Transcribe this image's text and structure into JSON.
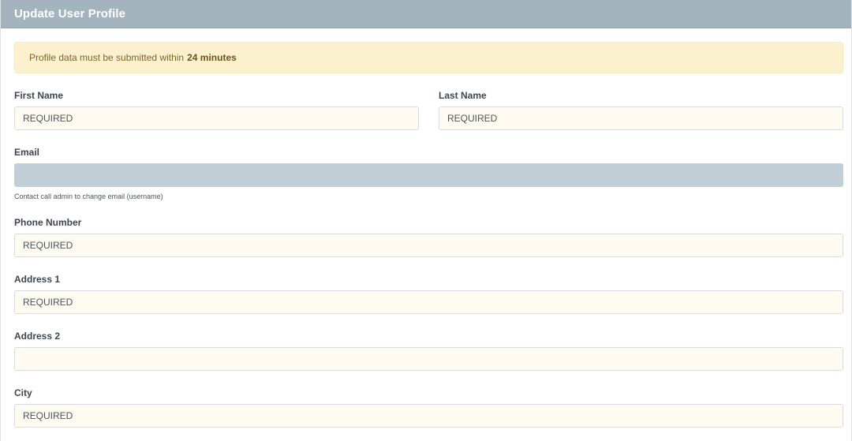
{
  "header": {
    "title": "Update User Profile"
  },
  "alert": {
    "text": "Profile data must be submitted within",
    "emphasis": "24 minutes"
  },
  "form": {
    "first_name": {
      "label": "First Name",
      "placeholder": "REQUIRED",
      "value": ""
    },
    "last_name": {
      "label": "Last Name",
      "placeholder": "REQUIRED",
      "value": ""
    },
    "email": {
      "label": "Email",
      "value": "",
      "help": "Contact call admin to change email (username)",
      "disabled": true
    },
    "phone": {
      "label": "Phone Number",
      "placeholder": "REQUIRED",
      "value": ""
    },
    "address1": {
      "label": "Address 1",
      "placeholder": "REQUIRED",
      "value": ""
    },
    "address2": {
      "label": "Address 2",
      "placeholder": "",
      "value": ""
    },
    "city": {
      "label": "City",
      "placeholder": "REQUIRED",
      "value": ""
    }
  },
  "colors": {
    "header_bg": "#a3b4bf",
    "alert_bg": "#fcf1cf",
    "input_bg": "#fffbf0",
    "disabled_bg": "#c2cfd7"
  }
}
